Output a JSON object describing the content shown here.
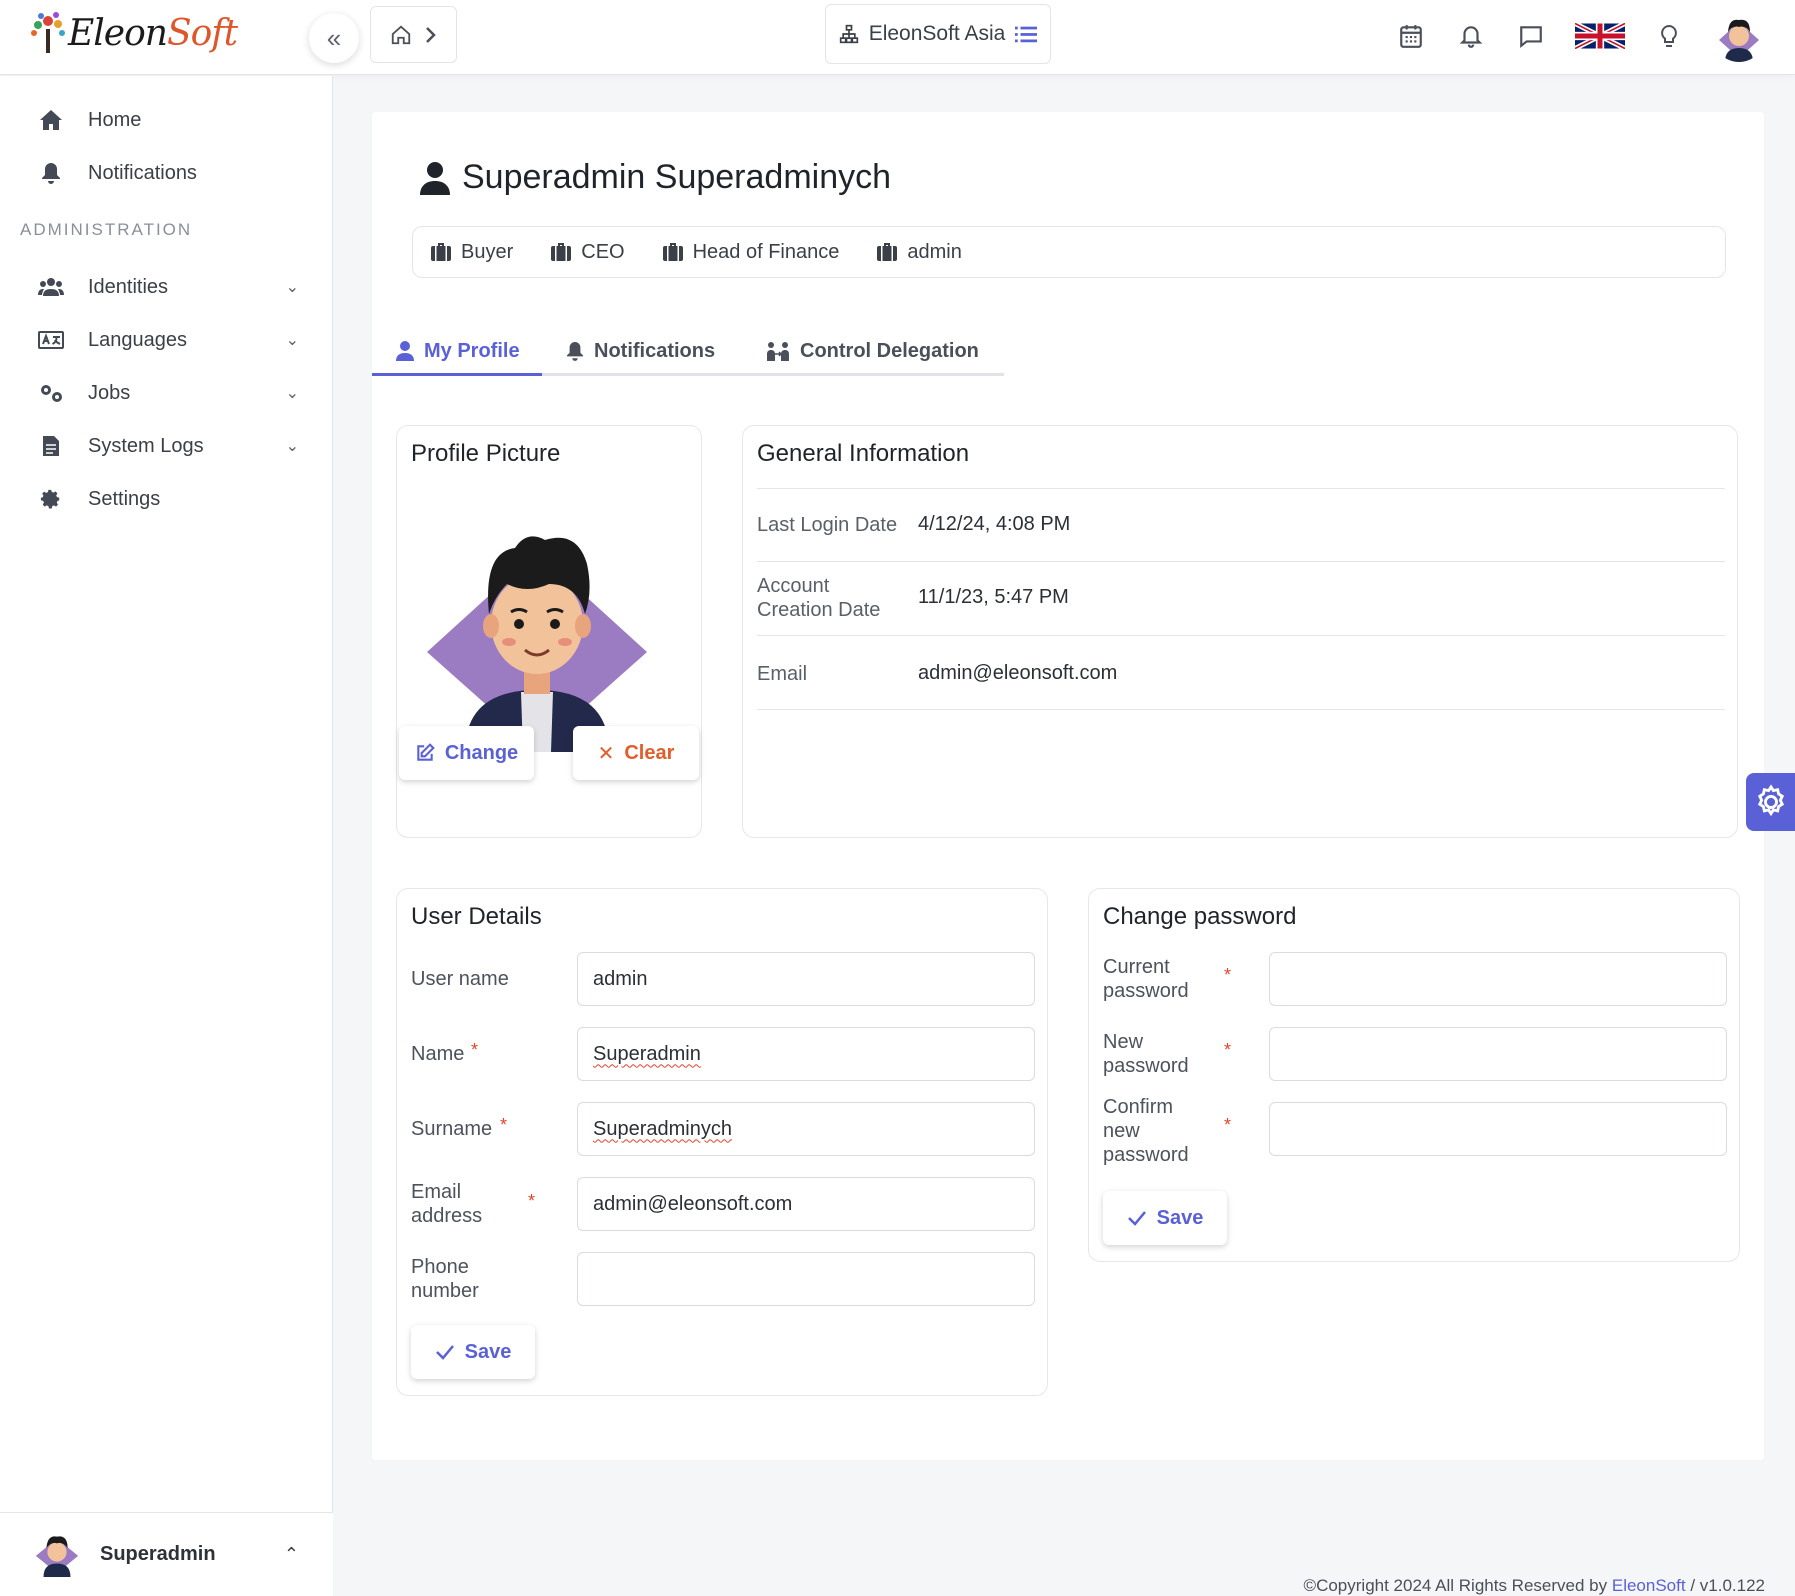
{
  "app": {
    "logo_part1": "Eleon",
    "logo_part2": "Soft",
    "tenant": "EleonSoft Asia"
  },
  "sidebar": {
    "items": [
      {
        "label": "Home",
        "icon": "home-icon"
      },
      {
        "label": "Notifications",
        "icon": "bell-icon"
      }
    ],
    "section_label": "ADMINISTRATION",
    "admin_items": [
      {
        "label": "Identities",
        "icon": "users-icon"
      },
      {
        "label": "Languages",
        "icon": "language-icon"
      },
      {
        "label": "Jobs",
        "icon": "gears-icon"
      },
      {
        "label": "System Logs",
        "icon": "file-icon"
      },
      {
        "label": "Settings",
        "icon": "gear-icon"
      }
    ],
    "user_name": "Superadmin"
  },
  "profile": {
    "title": "Superadmin Superadminych",
    "roles": [
      "Buyer",
      "CEO",
      "Head of Finance",
      "admin"
    ]
  },
  "tabs": [
    {
      "label": "My Profile",
      "active": true
    },
    {
      "label": "Notifications",
      "active": false
    },
    {
      "label": "Control Delegation",
      "active": false
    }
  ],
  "profile_picture": {
    "title": "Profile Picture",
    "change_label": "Change",
    "clear_label": "Clear"
  },
  "general_info": {
    "title": "General Information",
    "rows": [
      {
        "label": "Last Login Date",
        "value": "4/12/24, 4:08 PM"
      },
      {
        "label": "Account Creation Date",
        "value": "11/1/23, 5:47 PM"
      },
      {
        "label": "Email",
        "value": "admin@eleonsoft.com"
      }
    ]
  },
  "user_details": {
    "title": "User Details",
    "fields": [
      {
        "label": "User name",
        "value": "admin",
        "required": false
      },
      {
        "label": "Name",
        "value": "Superadmin",
        "required": true
      },
      {
        "label": "Surname",
        "value": "Superadminych",
        "required": true
      },
      {
        "label": "Email address",
        "value": "admin@eleonsoft.com",
        "required": true
      },
      {
        "label": "Phone number",
        "value": "",
        "required": false
      }
    ],
    "save_label": "Save"
  },
  "change_password": {
    "title": "Change password",
    "fields": [
      {
        "label": "Current password",
        "value": ""
      },
      {
        "label": "New password",
        "value": ""
      },
      {
        "label": "Confirm new password",
        "value": ""
      }
    ],
    "save_label": "Save"
  },
  "footer": {
    "text": "©Copyright 2024 All Rights Reserved by",
    "brand": "EleonSoft",
    "version": "/ v1.0.122"
  },
  "colors": {
    "accent": "#5a61d6",
    "danger": "#e35d2b",
    "required": "#e3452b"
  }
}
